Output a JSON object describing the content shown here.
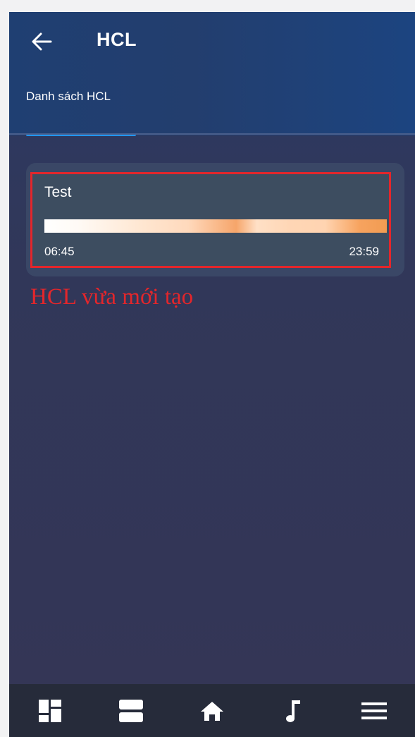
{
  "header": {
    "title": "HCL",
    "back_icon": "arrow-left-icon"
  },
  "tabs": [
    {
      "label": "Danh sách HCL",
      "active": true
    }
  ],
  "hcl_list": [
    {
      "name": "Test",
      "start_time": "06:45",
      "end_time": "23:59"
    }
  ],
  "annotation": {
    "text": "HCL vừa mới tạo",
    "color": "#e3262b"
  },
  "bottom_nav": [
    {
      "icon": "dashboard-icon"
    },
    {
      "icon": "rooms-icon"
    },
    {
      "icon": "home-icon"
    },
    {
      "icon": "music-icon"
    },
    {
      "icon": "menu-icon"
    }
  ],
  "colors": {
    "accent": "#2196f3",
    "header_bg": "#1f3f72",
    "body_bg": "#343656",
    "nav_bg": "#262b3a",
    "highlight": "#e3262b"
  }
}
